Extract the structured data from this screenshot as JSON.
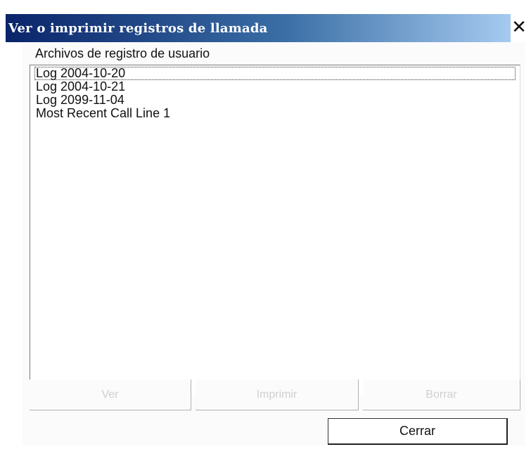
{
  "window": {
    "title": "Ver o imprimir registros de llamada",
    "close_glyph": "✕",
    "close_icon": "close-icon"
  },
  "group": {
    "label": "Archivos de registro de usuario"
  },
  "list": {
    "items": [
      "Log 2004-10-20",
      "Log 2004-10-21",
      "Log 2099-11-04",
      "Most Recent Call Line 1"
    ]
  },
  "buttons": {
    "view_label": "Ver",
    "print_label": "Imprimir",
    "delete_label": "Borrar",
    "close_label": "Cerrar"
  },
  "colors": {
    "title_gradient_start": "#0a246a",
    "title_gradient_end": "#a6caf0",
    "disabled_text": "#cfcfcf"
  }
}
